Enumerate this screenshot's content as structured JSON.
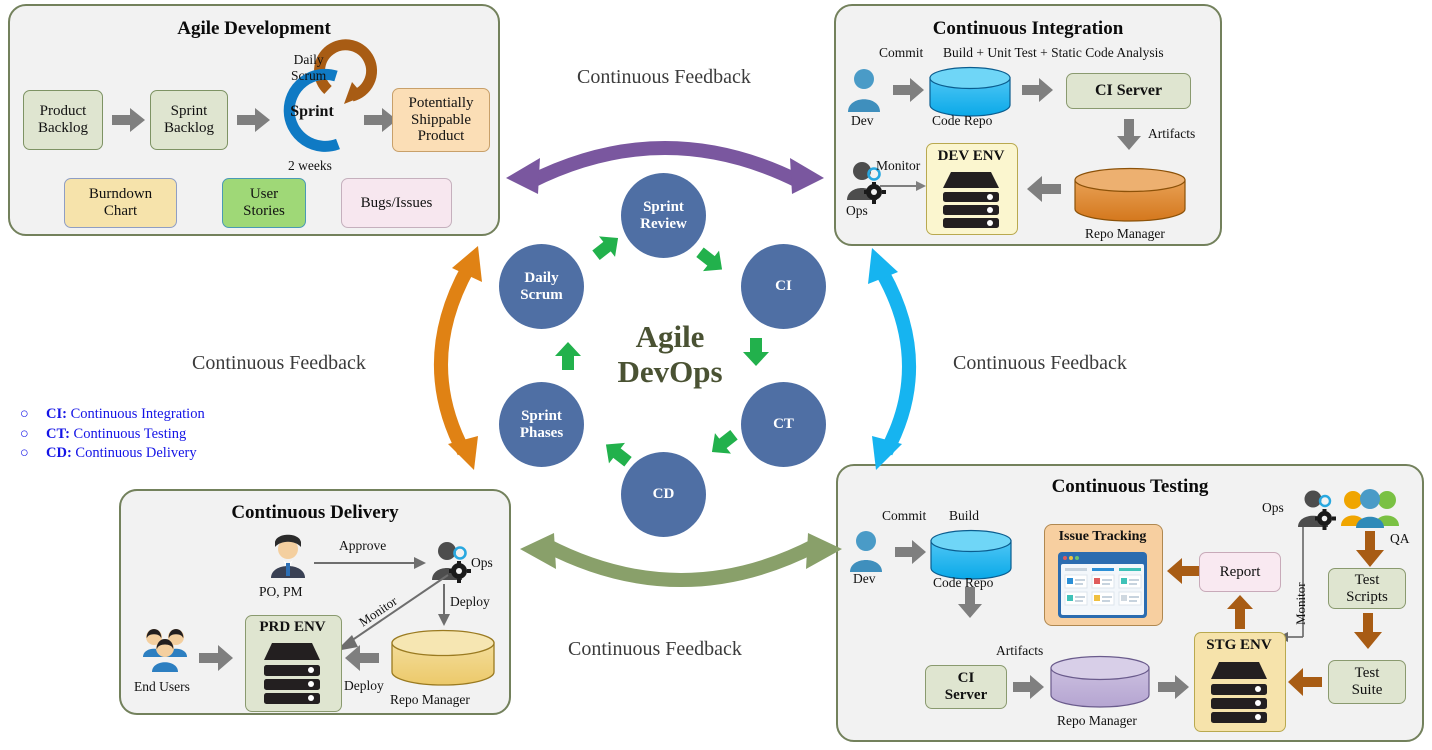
{
  "center": {
    "title_line1": "Agile",
    "title_line2": "DevOps",
    "nodes": [
      {
        "id": "sprint-review",
        "label": "Sprint\nReview"
      },
      {
        "id": "ci",
        "label": "CI"
      },
      {
        "id": "ct",
        "label": "CT"
      },
      {
        "id": "cd",
        "label": "CD"
      },
      {
        "id": "sprint-phases",
        "label": "Sprint\nPhases"
      },
      {
        "id": "daily-scrum",
        "label": "Daily\nScrum"
      }
    ]
  },
  "feedback_labels": {
    "top": "Continuous Feedback",
    "left": "Continuous Feedback",
    "right": "Continuous Feedback",
    "bottom": "Continuous Feedback"
  },
  "legend": [
    {
      "abbr": "CI:",
      "text": "Continuous Integration"
    },
    {
      "abbr": "CT:",
      "text": "Continuous Testing"
    },
    {
      "abbr": "CD:",
      "text": "Continuous Delivery"
    }
  ],
  "agile": {
    "title": "Agile Development",
    "product_backlog": "Product\nBacklog",
    "sprint_backlog": "Sprint\nBacklog",
    "sprint": "Sprint",
    "daily_scrum": "Daily\nScrum",
    "two_weeks": "2 weeks",
    "potentially_shippable": "Potentially\nShippable\nProduct",
    "burndown_chart": "Burndown\nChart",
    "user_stories": "User\nStories",
    "bugs_issues": "Bugs/Issues"
  },
  "ci_panel": {
    "title": "Continuous Integration",
    "commit": "Commit",
    "build_label": "Build + Unit Test + Static Code Analysis",
    "dev": "Dev",
    "code_repo": "Code Repo",
    "ci_server": "CI Server",
    "artifacts": "Artifacts",
    "ops": "Ops",
    "monitor": "Monitor",
    "dev_env": "DEV ENV",
    "repo_manager": "Repo Manager"
  },
  "ct_panel": {
    "title": "Continuous Testing",
    "commit": "Commit",
    "build": "Build",
    "dev": "Dev",
    "code_repo": "Code Repo",
    "issue_tracking": "Issue Tracking",
    "report": "Report",
    "ops": "Ops",
    "monitor": "Monitor",
    "qa": "QA",
    "test_scripts": "Test\nScripts",
    "test_suite": "Test\nSuite",
    "artifacts": "Artifacts",
    "ci_server": "CI\nServer",
    "repo_manager": "Repo Manager",
    "stg_env": "STG ENV"
  },
  "cd_panel": {
    "title": "Continuous Delivery",
    "approve": "Approve",
    "po_pm": "PO, PM",
    "ops": "Ops",
    "monitor": "Monitor",
    "deploy_right": "Deploy",
    "deploy_bottom": "Deploy",
    "end_users": "End Users",
    "prd_env": "PRD ENV",
    "repo_manager": "Repo Manager"
  },
  "colors": {
    "panel_border": "#73815c",
    "panel_bg": "#f2f2f2",
    "node_blue": "#4f6fa4",
    "green_arrow": "#22b14c",
    "purple_arrow": "#7a579f",
    "orange_arrow": "#e08214",
    "cyan_arrow": "#16b4f0",
    "olive_arrow": "#89a06a",
    "grey_arrow": "#808080",
    "brown_arrow": "#a85c14",
    "center_text": "#4a5233",
    "legend_text": "#1414e6"
  }
}
